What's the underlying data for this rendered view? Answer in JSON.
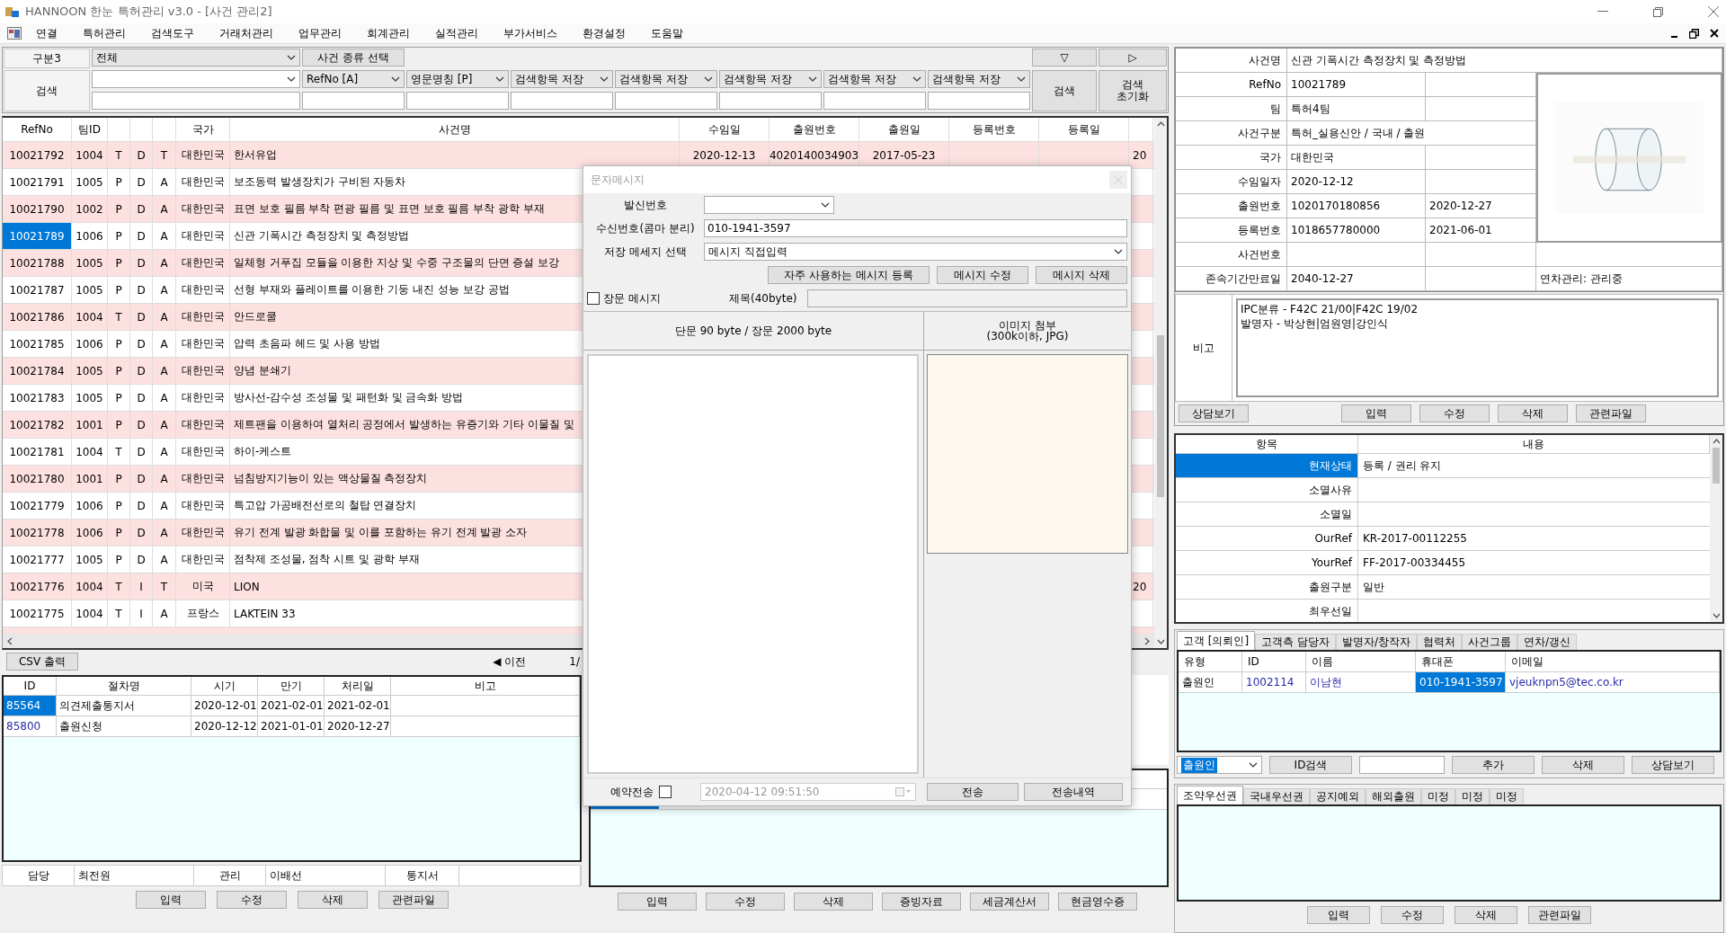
{
  "window": {
    "title": "HANNOON 한눈 특허관리 v3.0 - [사건 관리2]"
  },
  "menu": [
    "연결",
    "특허관리",
    "검색도구",
    "거래처관리",
    "업무관리",
    "회계관리",
    "실적관리",
    "부가서비스",
    "환경설정",
    "도움말"
  ],
  "filter": {
    "category_label": "구분3",
    "category_value": "전체",
    "type_button": "사건 종류 선택",
    "collapse_button": "▽",
    "next_button": "▷"
  },
  "search": {
    "label": "검색",
    "options": [
      "RefNo  [A]",
      "영문명칭  [P]",
      "검색항목 저장",
      "검색항목 저장",
      "검색항목 저장",
      "검색항목 저장",
      "검색항목 저장"
    ],
    "search_button": "검색",
    "reset_button": [
      "검색",
      "초기화"
    ]
  },
  "case_table": {
    "headers": {
      "refno": "RefNo",
      "team_id": "팀ID",
      "country": "국가",
      "case_name": "사건명",
      "received_date": "수임일",
      "app_no": "출원번호",
      "app_date": "출원일",
      "reg_no": "등록번호",
      "reg_date": "등록일"
    },
    "rows": [
      {
        "refno": "10021792",
        "team_id": "1004",
        "column_3": "T",
        "column_4": "D",
        "column_5": "T",
        "country": "대한민국",
        "case_name": "한서유업",
        "received_date": "2020-12-13",
        "app_no": "4020140034903",
        "app_date": "2017-05-23",
        "column_13": "20",
        "selected": false
      },
      {
        "refno": "10021791",
        "team_id": "1005",
        "column_3": "P",
        "column_4": "D",
        "column_5": "A",
        "country": "대한민국",
        "case_name": "보조동력 발생장치가 구비된 자동차",
        "selected": false
      },
      {
        "refno": "10021790",
        "team_id": "1002",
        "column_3": "P",
        "column_4": "D",
        "column_5": "A",
        "country": "대한민국",
        "case_name": "표면 보호 필름 부착 편광 필름 및 표면 보호 필름 부착 광학 부재",
        "selected": false
      },
      {
        "refno": "10021789",
        "team_id": "1006",
        "column_3": "P",
        "column_4": "D",
        "column_5": "A",
        "country": "대한민국",
        "case_name": "신관 기폭시간 측정장치 및 측정방법",
        "selected": true
      },
      {
        "refno": "10021788",
        "team_id": "1005",
        "column_3": "P",
        "column_4": "D",
        "column_5": "A",
        "country": "대한민국",
        "case_name": "일체형 거푸집 모듈을 이용한 지상 및 수중 구조물의 단면 증설 보강",
        "selected": false
      },
      {
        "refno": "10021787",
        "team_id": "1005",
        "column_3": "P",
        "column_4": "D",
        "column_5": "A",
        "country": "대한민국",
        "case_name": "선형 부재와 플레이트를 이용한 기둥 내진 성능 보강 공법",
        "selected": false
      },
      {
        "refno": "10021786",
        "team_id": "1004",
        "column_3": "T",
        "column_4": "D",
        "column_5": "A",
        "country": "대한민국",
        "case_name": "안드로쿨",
        "selected": false
      },
      {
        "refno": "10021785",
        "team_id": "1006",
        "column_3": "P",
        "column_4": "D",
        "column_5": "A",
        "country": "대한민국",
        "case_name": "압력 초음파 헤드 및 사용 방법",
        "selected": false
      },
      {
        "refno": "10021784",
        "team_id": "1005",
        "column_3": "P",
        "column_4": "D",
        "column_5": "A",
        "country": "대한민국",
        "case_name": "양념 분쇄기",
        "selected": false
      },
      {
        "refno": "10021783",
        "team_id": "1005",
        "column_3": "P",
        "column_4": "D",
        "column_5": "A",
        "country": "대한민국",
        "case_name": "방사선-감수성 조성물 및 패턴화 및 금속화 방법",
        "selected": false
      },
      {
        "refno": "10021782",
        "team_id": "1001",
        "column_3": "P",
        "column_4": "D",
        "column_5": "A",
        "country": "대한민국",
        "case_name": "제트팬을 이용하여 열처리 공정에서 발생하는 유증기와 기타 이물질 및",
        "selected": false
      },
      {
        "refno": "10021781",
        "team_id": "1004",
        "column_3": "T",
        "column_4": "D",
        "column_5": "A",
        "country": "대한민국",
        "case_name": "하이-케스트",
        "selected": false
      },
      {
        "refno": "10021780",
        "team_id": "1001",
        "column_3": "P",
        "column_4": "D",
        "column_5": "A",
        "country": "대한민국",
        "case_name": "넘침방지기능이 있는 액상물질 측정장치",
        "selected": false
      },
      {
        "refno": "10021779",
        "team_id": "1006",
        "column_3": "P",
        "column_4": "D",
        "column_5": "A",
        "country": "대한민국",
        "case_name": "특고압 가공배전선로의 철탑 연결장치",
        "selected": false
      },
      {
        "refno": "10021778",
        "team_id": "1006",
        "column_3": "P",
        "column_4": "D",
        "column_5": "A",
        "country": "대한민국",
        "case_name": "유기 전계 발광 화합물 및 이를 포함하는 유기 전계 발광 소자",
        "selected": false
      },
      {
        "refno": "10021777",
        "team_id": "1005",
        "column_3": "P",
        "column_4": "D",
        "column_5": "A",
        "country": "대한민국",
        "case_name": "점착제 조성물, 점착 시트 및 광학 부재",
        "selected": false
      },
      {
        "refno": "10021776",
        "team_id": "1004",
        "column_3": "T",
        "column_4": "I",
        "column_5": "T",
        "country": "미국",
        "case_name": "LION",
        "column_13": "20",
        "selected": false
      },
      {
        "refno": "10021775",
        "team_id": "1004",
        "column_3": "T",
        "column_4": "I",
        "column_5": "A",
        "country": "프랑스",
        "case_name": "LAKTEIN 33",
        "selected": false
      }
    ]
  },
  "pager": {
    "csv_button": "CSV 출력",
    "prev": "◀ 이전",
    "page": "1/"
  },
  "procedures": {
    "columns": [
      "ID",
      "절차명",
      "시기",
      "만기",
      "처리일",
      "비고"
    ],
    "rows": [
      {
        "id": "85564",
        "name": "의견제출통지서",
        "start": "2020-12-01",
        "due": "2021-02-01",
        "done": "2021-02-01",
        "selected": true
      },
      {
        "id": "85800",
        "name": "출원신청",
        "start": "2020-12-12",
        "due": "2021-01-01",
        "done": "2020-12-27",
        "selected": false
      }
    ],
    "footer": [
      "담당",
      "최전원",
      "관리",
      "이배선",
      "통지서"
    ],
    "buttons": [
      "입력",
      "수정",
      "삭제",
      "관련파일"
    ]
  },
  "billing": {
    "rows": [
      {
        "selected": true
      }
    ],
    "buttons": [
      "입력",
      "수정",
      "삭제",
      "증빙자료",
      "세금계산서",
      "현금영수증"
    ]
  },
  "sms_dialog": {
    "title": "문자메시지",
    "sender_label": "발신번호",
    "recipient_label": "수신번호(콤마 분리)",
    "recipient_value": "010-1941-3597",
    "saved_label": "저장 메세지 선택",
    "saved_value": "메시지 직접입력",
    "buttons": [
      "자주 사용하는 메시지 등록",
      "메시지 수정",
      "메시지 삭제"
    ],
    "long_message": {
      "label": "장문 메시지",
      "checked": false
    },
    "subject_label": "제목(40byte)",
    "body_header": "단문 90 byte / 장문 2000 byte",
    "image_header": [
      "이미지 첨부",
      "(300k이하, JPG)"
    ],
    "reserve": {
      "label": "예약전송",
      "checked": false,
      "datetime": "2020-04-12 09:51:50"
    },
    "send_buttons": [
      "전송",
      "전송내역"
    ]
  },
  "case_info": {
    "title_row": {
      "label": "사건명",
      "value": "신관 기폭시간 측정장치 및 측정방법"
    },
    "rows": [
      {
        "label": "RefNo",
        "value": "10021789"
      },
      {
        "label": "팀",
        "value": "특허4팀"
      },
      {
        "label": "사건구분",
        "value": "특허_실용신안 / 국내 / 출원",
        "kind": "wide"
      },
      {
        "label": "국가",
        "value": "대한민국"
      },
      {
        "label": "수임일자",
        "value": "2020-12-12"
      },
      {
        "label": "출원번호",
        "value": "1020170180856",
        "date": "2020-12-27"
      },
      {
        "label": "등록번호",
        "value": "1018657780000",
        "date": "2021-06-01"
      },
      {
        "label": "사건번호"
      },
      {
        "label": "존속기간만료일",
        "value": "2040-12-27",
        "note": "연차관리: 관리중"
      }
    ],
    "image": {
      "kind": "picture"
    },
    "remark_label": "비고",
    "remark_lines": [
      "IPC분류 - F42C 21/00|F42C 19/02",
      "발명자 - 박상현|엄원영|강인식"
    ],
    "consult_button": "상담보기",
    "buttons": [
      "입력",
      "수정",
      "삭제",
      "관련파일"
    ]
  },
  "status_table": {
    "columns": [
      "항목",
      "내용"
    ],
    "rows": [
      {
        "label": "현재상태",
        "value": "등록 / 권리 유지",
        "selected": true
      },
      {
        "label": "소멸사유",
        "selected": false
      },
      {
        "label": "소멸일",
        "selected": false
      },
      {
        "label": "OurRef",
        "value": "KR-2017-00112255",
        "selected": false
      },
      {
        "label": "YourRef",
        "value": "FF-2017-00334455",
        "selected": false
      },
      {
        "label": "출원구분",
        "value": "일반",
        "selected": false
      },
      {
        "label": "최우선일",
        "selected": false
      }
    ]
  },
  "client_tabs": [
    {
      "label": "고객 [의뢰인]",
      "selected": true
    },
    {
      "label": "고객측 담당자",
      "selected": false
    },
    {
      "label": "발명자/창작자",
      "selected": false
    },
    {
      "label": "협력처",
      "selected": false
    },
    {
      "label": "사건그룹",
      "selected": false
    },
    {
      "label": "연차/갱신",
      "selected": false
    }
  ],
  "client_table": {
    "columns": [
      "유형",
      "ID",
      "이름",
      "휴대폰",
      "이메일"
    ],
    "rows": [
      {
        "type": "출원인",
        "id": "1002114",
        "name": "이남현",
        "phone": "010-1941-3597",
        "email": "vjeuknpn5@tec.co.kr",
        "phone_selected": true
      }
    ]
  },
  "client_controls": {
    "type_select": "출원인",
    "id_search": "ID검색",
    "buttons": [
      "추가",
      "삭제",
      "상담보기"
    ]
  },
  "priority_tabs": [
    {
      "label": "조약우선권",
      "selected": true
    },
    {
      "label": "국내우선권",
      "selected": false
    },
    {
      "label": "공지예외",
      "selected": false
    },
    {
      "label": "해외출원",
      "selected": false
    },
    {
      "label": "미정",
      "selected": false
    },
    {
      "label": "미정",
      "selected": false
    },
    {
      "label": "미정",
      "selected": false
    }
  ],
  "priority_buttons": [
    "입력",
    "수정",
    "삭제",
    "관련파일"
  ]
}
